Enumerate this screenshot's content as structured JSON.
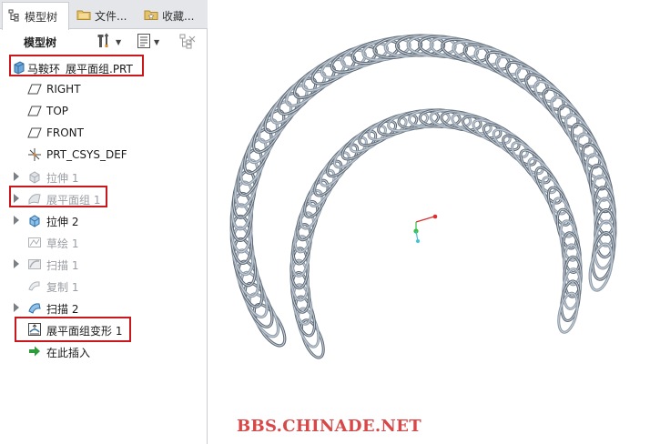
{
  "tabs": [
    {
      "label": "模型树",
      "icon": "model-tree-icon",
      "active": true
    },
    {
      "label": "文件...",
      "icon": "folder-icon",
      "active": false
    },
    {
      "label": "收藏...",
      "icon": "favorites-icon",
      "active": false
    }
  ],
  "toolbar": {
    "title": "模型树",
    "tools": [
      "settings-icon",
      "tree-filter-icon",
      "show-hide-icon"
    ]
  },
  "tree": {
    "root": {
      "label": "马鞍环_展平面组.PRT",
      "icon": "part-icon"
    },
    "items": [
      {
        "label": "RIGHT",
        "icon": "datum-plane-icon",
        "expandable": false,
        "dim": false
      },
      {
        "label": "TOP",
        "icon": "datum-plane-icon",
        "expandable": false,
        "dim": false
      },
      {
        "label": "FRONT",
        "icon": "datum-plane-icon",
        "expandable": false,
        "dim": false
      },
      {
        "label": "PRT_CSYS_DEF",
        "icon": "csys-icon",
        "expandable": false,
        "dim": false
      },
      {
        "label": "拉伸 1",
        "icon": "extrude-icon",
        "expandable": true,
        "dim": true
      },
      {
        "label": "展平面组 1",
        "icon": "flatten-quilt-icon",
        "expandable": true,
        "dim": true
      },
      {
        "label": "拉伸 2",
        "icon": "extrude-icon",
        "expandable": true,
        "dim": false
      },
      {
        "label": "草绘 1",
        "icon": "sketch-icon",
        "expandable": false,
        "dim": true
      },
      {
        "label": "扫描 1",
        "icon": "sweep-icon",
        "expandable": true,
        "dim": true
      },
      {
        "label": "复制 1",
        "icon": "copy-icon",
        "expandable": false,
        "dim": true
      },
      {
        "label": "扫描 2",
        "icon": "sweep-icon",
        "expandable": true,
        "dim": false
      },
      {
        "label": "展平面组变形 1",
        "icon": "flatten-deform-icon",
        "expandable": false,
        "dim": false
      },
      {
        "label": "在此插入",
        "icon": "insert-here-icon",
        "expandable": false,
        "dim": false
      }
    ]
  },
  "colors": {
    "highlight": "#c8181e",
    "spring": "#8d99a6",
    "spring_dark": "#5d6874",
    "spring_light": "#c7d0d9",
    "watermark": "#d84848"
  },
  "viewport": {
    "watermark": "BBS.CHINADE.NET"
  }
}
